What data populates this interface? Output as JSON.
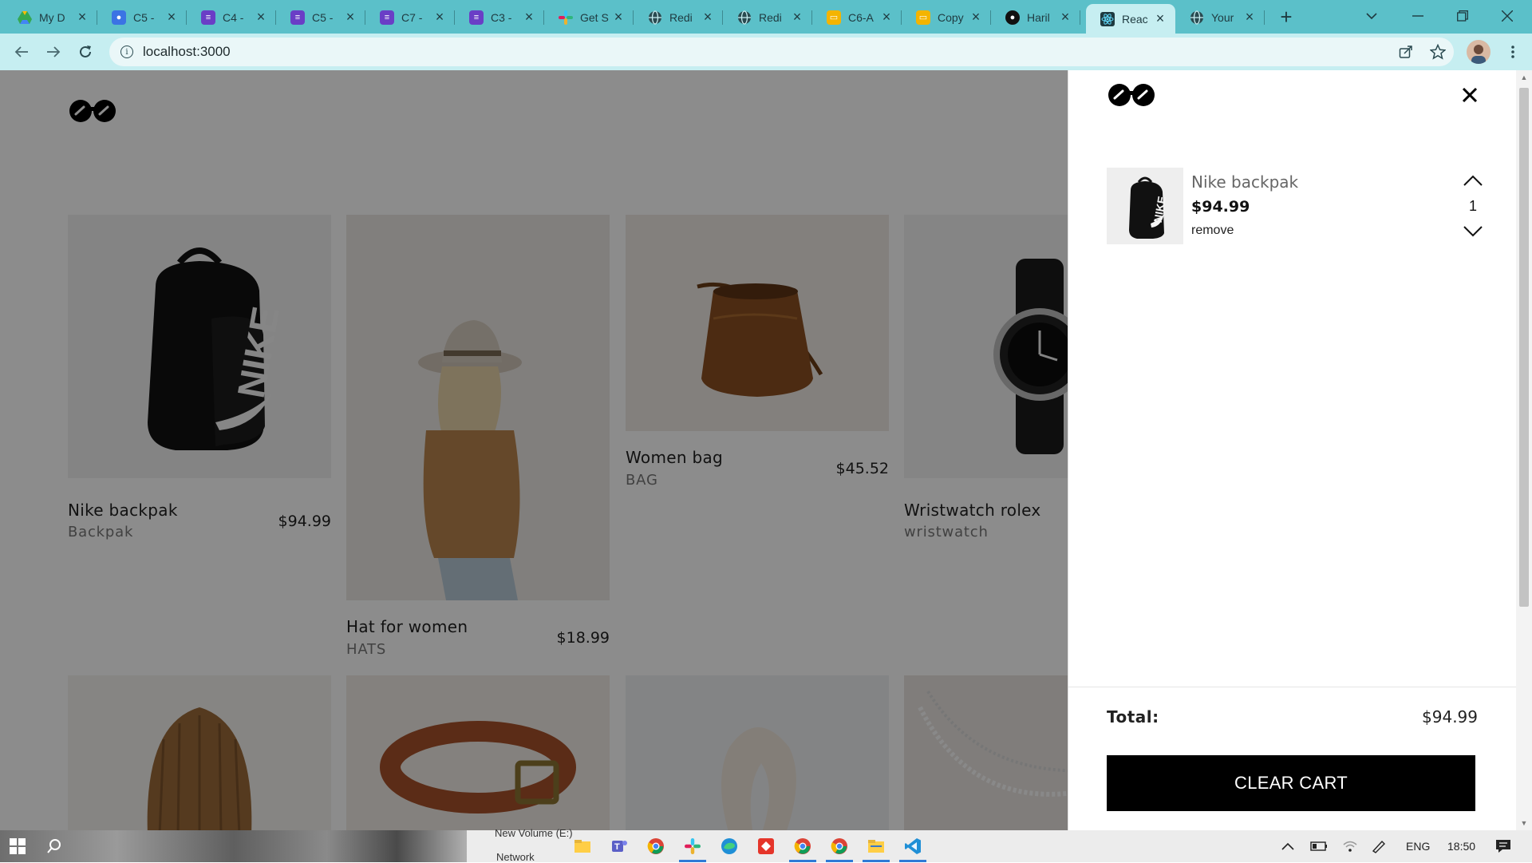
{
  "browser": {
    "tabs": [
      {
        "label": "My D",
        "icon": "google-drive-icon",
        "color": "#34a853",
        "active": false
      },
      {
        "label": "C5 -",
        "icon": "contacts-icon",
        "color": "#3b73e4",
        "active": false
      },
      {
        "label": "C4 -",
        "icon": "forms-icon",
        "color": "#6a3ec6",
        "active": false
      },
      {
        "label": "C5 -",
        "icon": "forms-icon",
        "color": "#6a3ec6",
        "active": false
      },
      {
        "label": "C7 -",
        "icon": "forms-icon",
        "color": "#6a3ec6",
        "active": false
      },
      {
        "label": "C3 -",
        "icon": "forms-icon",
        "color": "#6a3ec6",
        "active": false
      },
      {
        "label": "Get S",
        "icon": "slack-icon",
        "color": "#e01e5a",
        "active": false
      },
      {
        "label": "Redi",
        "icon": "globe-icon",
        "color": "#2a4a50",
        "active": false
      },
      {
        "label": "Redi",
        "icon": "globe-icon",
        "color": "#2a4a50",
        "active": false
      },
      {
        "label": "C6-A",
        "icon": "slides-icon",
        "color": "#f4b400",
        "active": false
      },
      {
        "label": "Copy",
        "icon": "slides-icon",
        "color": "#f4b400",
        "active": false
      },
      {
        "label": "Haril",
        "icon": "github-icon",
        "color": "#111111",
        "active": false
      },
      {
        "label": "Reac",
        "icon": "react-icon",
        "color": "#1f3a40",
        "active": true
      },
      {
        "label": "Your",
        "icon": "globe-icon",
        "color": "#2a4a50",
        "active": false
      }
    ],
    "url": "localhost:3000"
  },
  "products": [
    {
      "name": "Nike backpak",
      "category": "Backpak",
      "price": "$94.99",
      "image": "backpack-image"
    },
    {
      "name": "Hat for women",
      "category": "HATS",
      "price": "$18.99",
      "image": "woman-hat-image"
    },
    {
      "name": "Women bag",
      "category": "BAG",
      "price": "$45.52",
      "image": "leather-bag-image"
    },
    {
      "name": "Wristwatch rolex",
      "category": "wristwatch",
      "price": "",
      "image": "wristwatch-image"
    },
    {
      "name": "",
      "category": "",
      "price": "",
      "image": "beanie-image"
    },
    {
      "name": "",
      "category": "",
      "price": "",
      "image": "belt-image"
    },
    {
      "name": "",
      "category": "",
      "price": "",
      "image": "scarf-image"
    },
    {
      "name": "",
      "category": "",
      "price": "",
      "image": "necklace-image"
    }
  ],
  "cart": {
    "items": [
      {
        "name": "Nike backpak",
        "price": "$94.99",
        "quantity": "1",
        "remove_label": "remove"
      }
    ],
    "total_label": "Total:",
    "total_value": "$94.99",
    "clear_label": "CLEAR CART"
  },
  "taskbar": {
    "drive_hint": "New Volume (E:)",
    "network_hint": "Network",
    "language": "ENG",
    "time": "18:50"
  },
  "colors": {
    "tabbar": "#5bc0c9",
    "toolbar": "#c6eef1",
    "overlay": "rgba(0,0,0,0.45)",
    "cart_button": "#000000"
  }
}
